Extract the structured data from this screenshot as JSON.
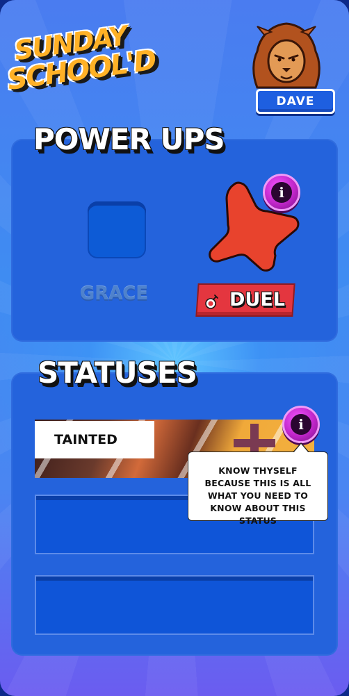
{
  "header": {
    "logo_line1": "SUNDAY",
    "logo_line2": "SCHOOL'D",
    "player_name": "DAVE",
    "avatar_icon": "lion-avatar-icon"
  },
  "powerups": {
    "title": "POWER UPS",
    "slot_label": "GRACE",
    "active_label": "DUEL",
    "active_icon": "bomb-icon",
    "info_glyph": "i"
  },
  "statuses": {
    "title": "STATUSES",
    "item_label": "TAINTED",
    "info_glyph": "i",
    "tooltip": "KNOW THYSELF BECAUSE THIS IS ALL WHAT YOU NEED TO KNOW ABOUT THIS STATUS"
  },
  "colors": {
    "panel": "#2463dc",
    "star": "#e8432d",
    "duel_badge": "#e4363f",
    "info_button": "#c026c9",
    "logo": "#ffb126"
  }
}
